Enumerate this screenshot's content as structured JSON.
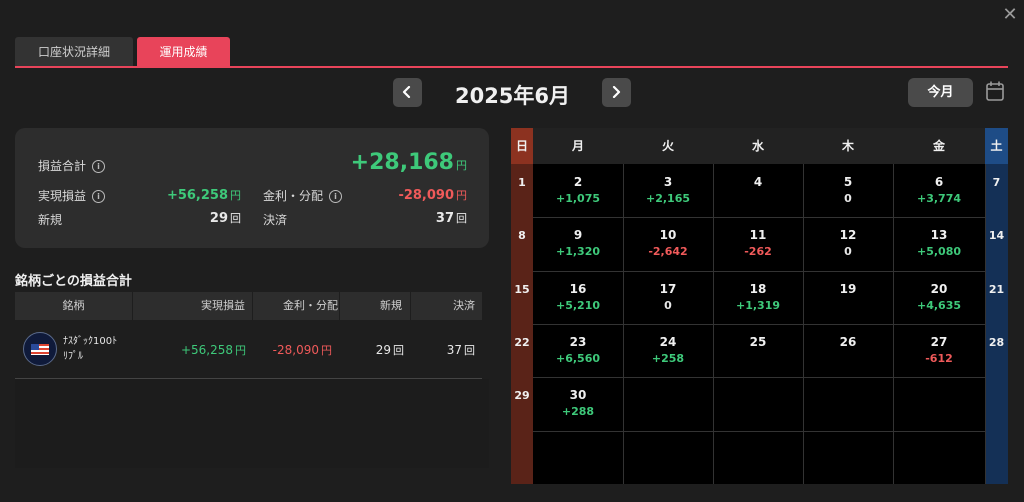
{
  "tabs": [
    {
      "label": "口座状況詳細",
      "active": false
    },
    {
      "label": "運用成績",
      "active": true
    }
  ],
  "header": {
    "month": "2025年6月",
    "today_label": "今月",
    "prev_icon": "chevron-left-icon",
    "next_icon": "chevron-right-icon",
    "calendar_icon": "calendar-icon",
    "close_icon": "close-icon"
  },
  "summary": {
    "total_label": "損益合計",
    "total_value": "+28,168",
    "realized_label": "実現損益",
    "realized_value": "+56,258",
    "interest_label": "金利・分配",
    "interest_value": "-28,090",
    "new_label": "新規",
    "new_value": "29",
    "settle_label": "決済",
    "settle_value": "37",
    "yen": "円",
    "times": "回",
    "info_icon": "i"
  },
  "table": {
    "title": "銘柄ごとの損益合計",
    "headers": [
      "銘柄",
      "実現損益",
      "金利・分配",
      "新規",
      "決済"
    ],
    "rows": [
      {
        "name_line1": "ﾅｽﾀﾞｯｸ100ﾄ",
        "name_line2": "ﾘﾌﾟﾙ",
        "realized": "+56,258",
        "interest": "-28,090",
        "new": "29",
        "settle": "37"
      }
    ]
  },
  "calendar": {
    "weekdays": [
      "日",
      "月",
      "火",
      "水",
      "木",
      "金",
      "土"
    ],
    "weeks": [
      {
        "sun": "1",
        "sat": "7",
        "days": [
          {
            "d": "2",
            "v": "+1,075"
          },
          {
            "d": "3",
            "v": "+2,165"
          },
          {
            "d": "4",
            "v": ""
          },
          {
            "d": "5",
            "v": "0"
          },
          {
            "d": "6",
            "v": "+3,774"
          }
        ]
      },
      {
        "sun": "8",
        "sat": "14",
        "days": [
          {
            "d": "9",
            "v": "+1,320"
          },
          {
            "d": "10",
            "v": "-2,642"
          },
          {
            "d": "11",
            "v": "-262"
          },
          {
            "d": "12",
            "v": "0"
          },
          {
            "d": "13",
            "v": "+5,080"
          }
        ]
      },
      {
        "sun": "15",
        "sat": "21",
        "days": [
          {
            "d": "16",
            "v": "+5,210"
          },
          {
            "d": "17",
            "v": "0"
          },
          {
            "d": "18",
            "v": "+1,319"
          },
          {
            "d": "19",
            "v": ""
          },
          {
            "d": "20",
            "v": "+4,635"
          }
        ]
      },
      {
        "sun": "22",
        "sat": "28",
        "days": [
          {
            "d": "23",
            "v": "+6,560"
          },
          {
            "d": "24",
            "v": "+258"
          },
          {
            "d": "25",
            "v": ""
          },
          {
            "d": "26",
            "v": ""
          },
          {
            "d": "27",
            "v": "-612"
          }
        ]
      },
      {
        "sun": "29",
        "sat": "",
        "days": [
          {
            "d": "30",
            "v": "+288"
          },
          {
            "d": "",
            "v": ""
          },
          {
            "d": "",
            "v": ""
          },
          {
            "d": "",
            "v": ""
          },
          {
            "d": "",
            "v": ""
          }
        ]
      },
      {
        "sun": "",
        "sat": "",
        "days": [
          {
            "d": "",
            "v": ""
          },
          {
            "d": "",
            "v": ""
          },
          {
            "d": "",
            "v": ""
          },
          {
            "d": "",
            "v": ""
          },
          {
            "d": "",
            "v": ""
          }
        ]
      }
    ]
  },
  "colors": {
    "positive": "#3ec97a",
    "negative": "#f05a5a",
    "accent": "#e8445a"
  }
}
